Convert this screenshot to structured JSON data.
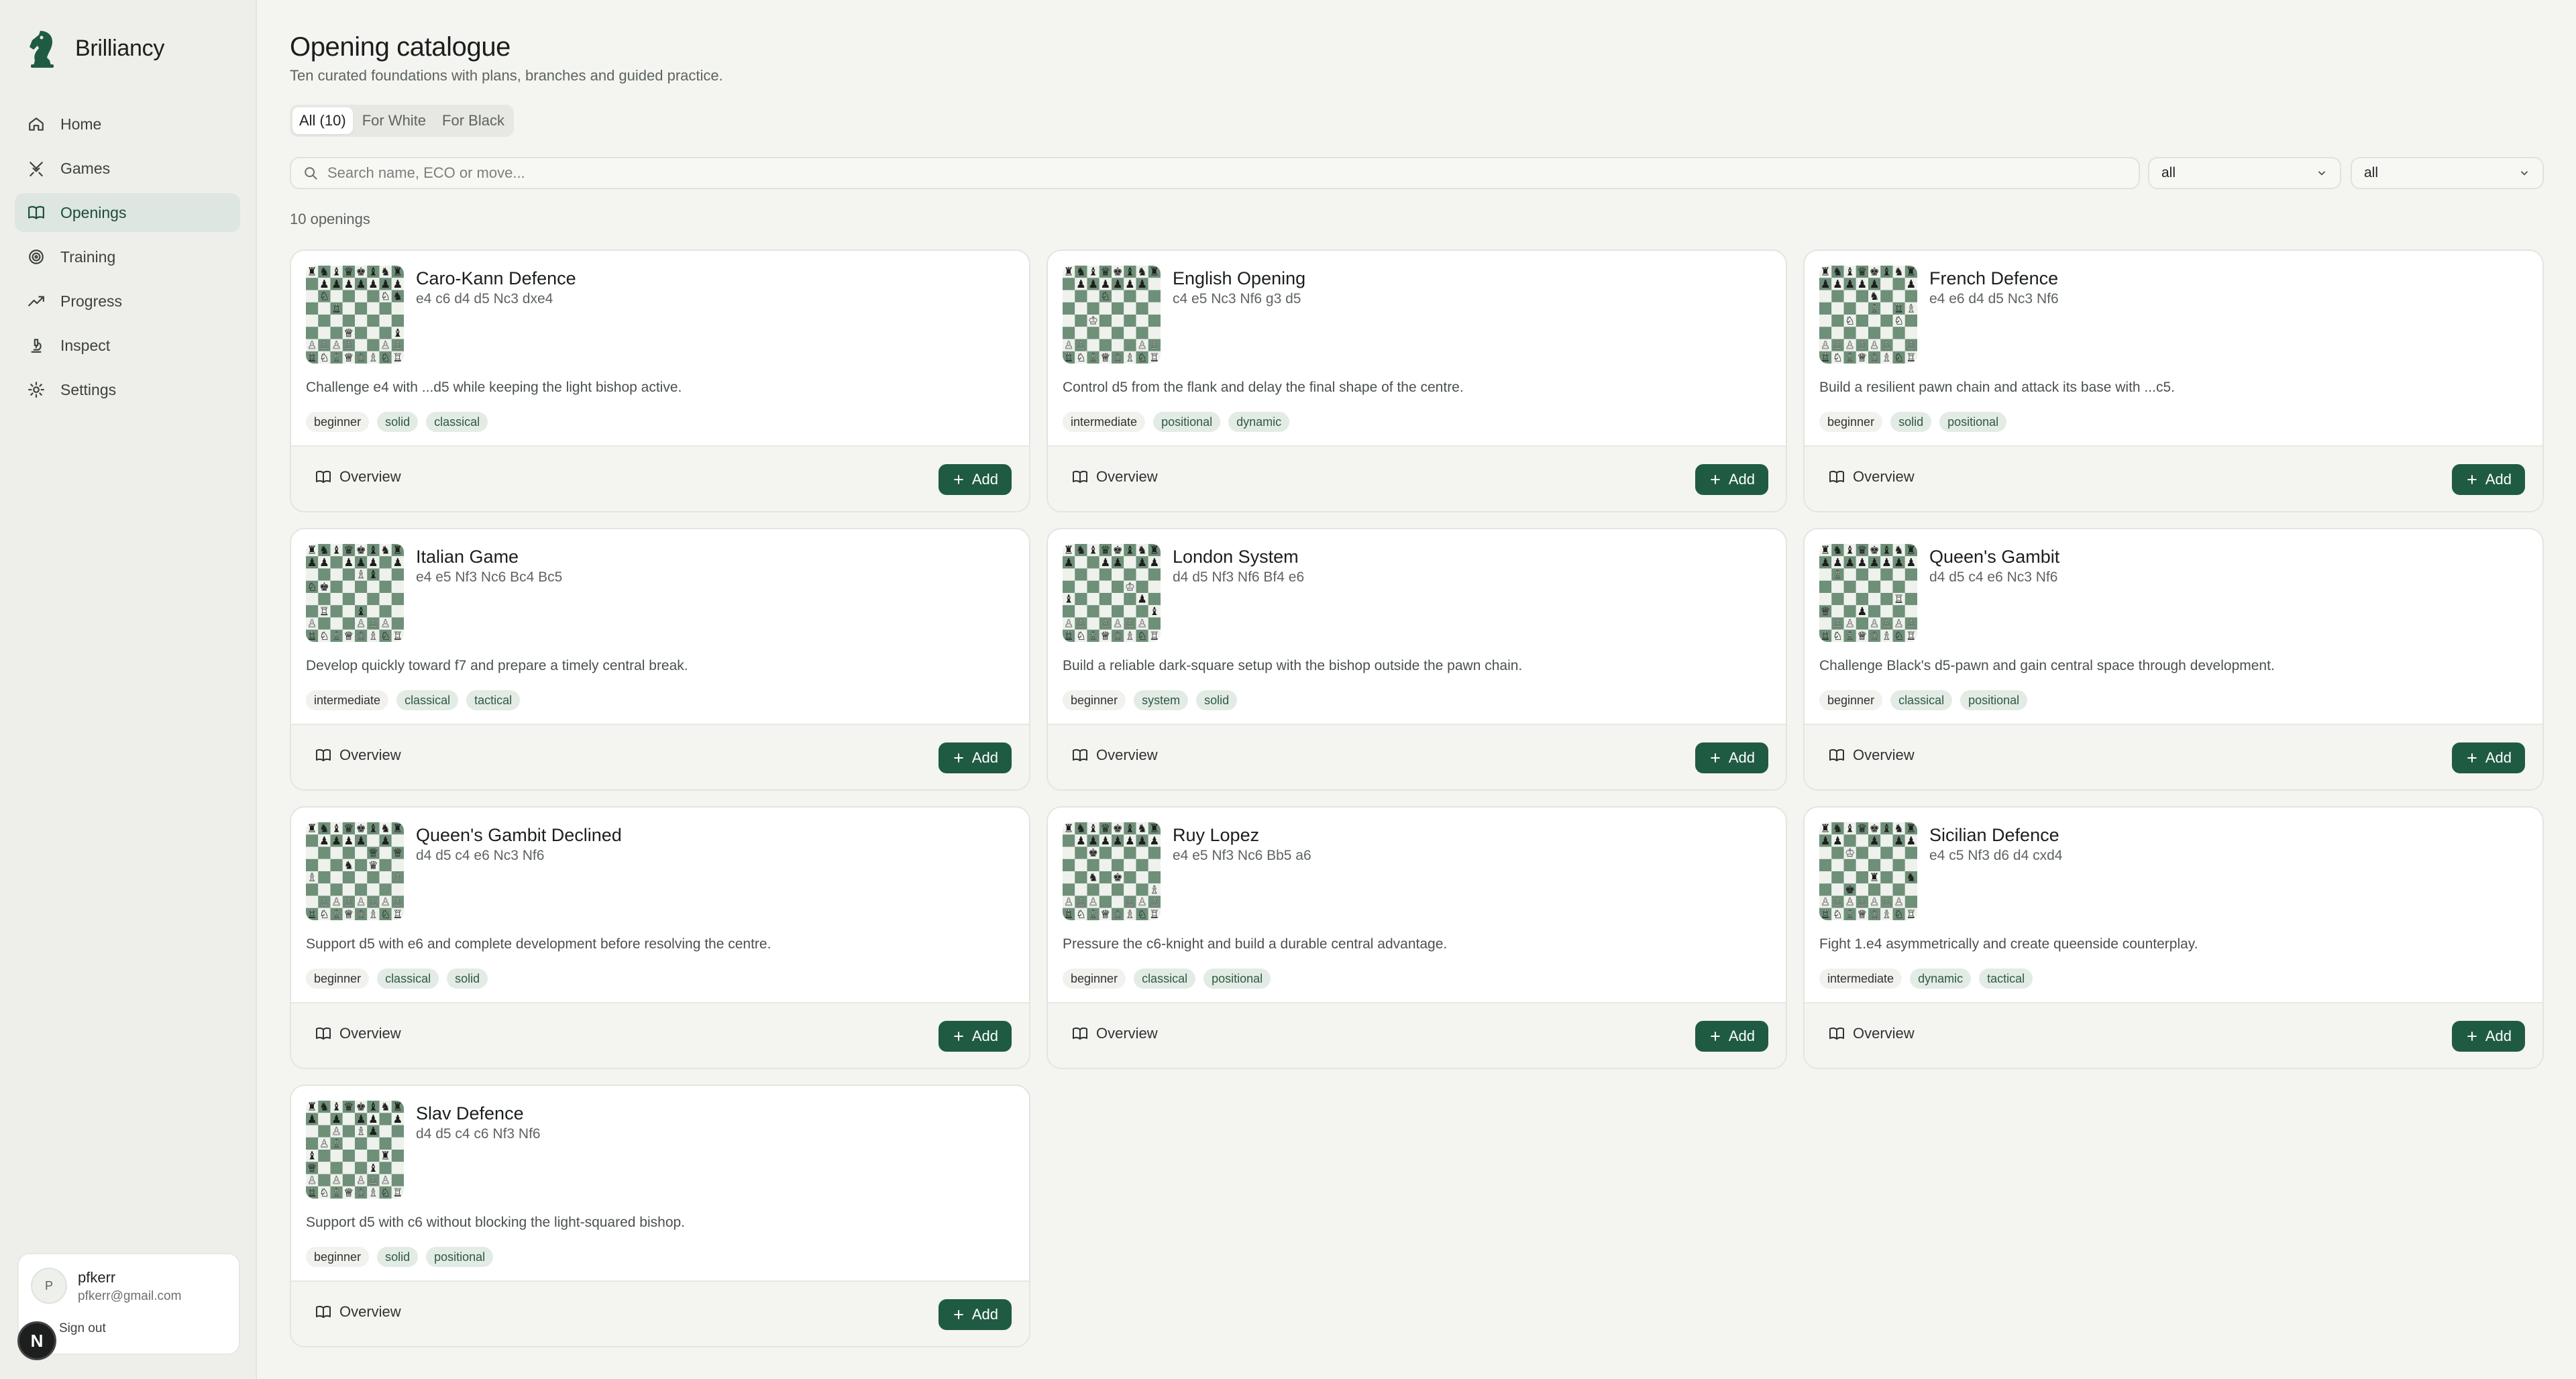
{
  "app": {
    "name": "Brilliancy"
  },
  "nav": [
    {
      "label": "Home",
      "icon": "home-icon",
      "active": false
    },
    {
      "label": "Games",
      "icon": "swords-icon",
      "active": false
    },
    {
      "label": "Openings",
      "icon": "book-icon",
      "active": true
    },
    {
      "label": "Training",
      "icon": "target-icon",
      "active": false
    },
    {
      "label": "Progress",
      "icon": "trend-up-icon",
      "active": false
    },
    {
      "label": "Inspect",
      "icon": "microscope-icon",
      "active": false
    },
    {
      "label": "Settings",
      "icon": "gear-icon",
      "active": false
    }
  ],
  "user": {
    "initial": "P",
    "name": "pfkerr",
    "email": "pfkerr@gmail.com",
    "signout": "Sign out",
    "badge": "N"
  },
  "page": {
    "title": "Opening catalogue",
    "subtitle": "Ten curated foundations with plans, branches and guided practice.",
    "tabs": [
      {
        "label": "All (10)",
        "active": true
      },
      {
        "label": "For White",
        "active": false
      },
      {
        "label": "For Black",
        "active": false
      }
    ],
    "search_placeholder": "Search name, ECO or move...",
    "filter1": "all",
    "filter2": "all",
    "count": "10 openings"
  },
  "card_labels": {
    "overview": "Overview",
    "add": "Add"
  },
  "colors": {
    "accent": "#1f5b43",
    "board_dark": "#6e8f78",
    "board_light": "#eef1ec"
  },
  "openings": [
    {
      "name": "Caro-Kann Defence",
      "moves": "e4 c6 d4 d5 Nc3 dxe4",
      "desc": "Challenge e4 with ...d5 while keeping the light bishop active.",
      "tags": [
        "beginner",
        "solid",
        "classical"
      ]
    },
    {
      "name": "English Opening",
      "moves": "c4 e5 Nc3 Nf6 g3 d5",
      "desc": "Control d5 from the flank and delay the final shape of the centre.",
      "tags": [
        "intermediate",
        "positional",
        "dynamic"
      ]
    },
    {
      "name": "French Defence",
      "moves": "e4 e6 d4 d5 Nc3 Nf6",
      "desc": "Build a resilient pawn chain and attack its base with ...c5.",
      "tags": [
        "beginner",
        "solid",
        "positional"
      ]
    },
    {
      "name": "Italian Game",
      "moves": "e4 e5 Nf3 Nc6 Bc4 Bc5",
      "desc": "Develop quickly toward f7 and prepare a timely central break.",
      "tags": [
        "intermediate",
        "classical",
        "tactical"
      ]
    },
    {
      "name": "London System",
      "moves": "d4 d5 Nf3 Nf6 Bf4 e6",
      "desc": "Build a reliable dark-square setup with the bishop outside the pawn chain.",
      "tags": [
        "beginner",
        "system",
        "solid"
      ]
    },
    {
      "name": "Queen's Gambit",
      "moves": "d4 d5 c4 e6 Nc3 Nf6",
      "desc": "Challenge Black's d5-pawn and gain central space through development.",
      "tags": [
        "beginner",
        "classical",
        "positional"
      ]
    },
    {
      "name": "Queen's Gambit Declined",
      "moves": "d4 d5 c4 e6 Nc3 Nf6",
      "desc": "Support d5 with e6 and complete development before resolving the centre.",
      "tags": [
        "beginner",
        "classical",
        "solid"
      ]
    },
    {
      "name": "Ruy Lopez",
      "moves": "e4 e5 Nf3 Nc6 Bb5 a6",
      "desc": "Pressure the c6-knight and build a durable central advantage.",
      "tags": [
        "beginner",
        "classical",
        "positional"
      ]
    },
    {
      "name": "Sicilian Defence",
      "moves": "e4 c5 Nf3 d6 d4 cxd4",
      "desc": "Fight 1.e4 asymmetrically and create queenside counterplay.",
      "tags": [
        "intermediate",
        "dynamic",
        "tactical"
      ]
    },
    {
      "name": "Slav Defence",
      "moves": "d4 d5 c4 c6 Nf3 Nf6",
      "desc": "Support d5 with c6 without blocking the light-squared bishop.",
      "tags": [
        "beginner",
        "solid",
        "positional"
      ]
    }
  ]
}
